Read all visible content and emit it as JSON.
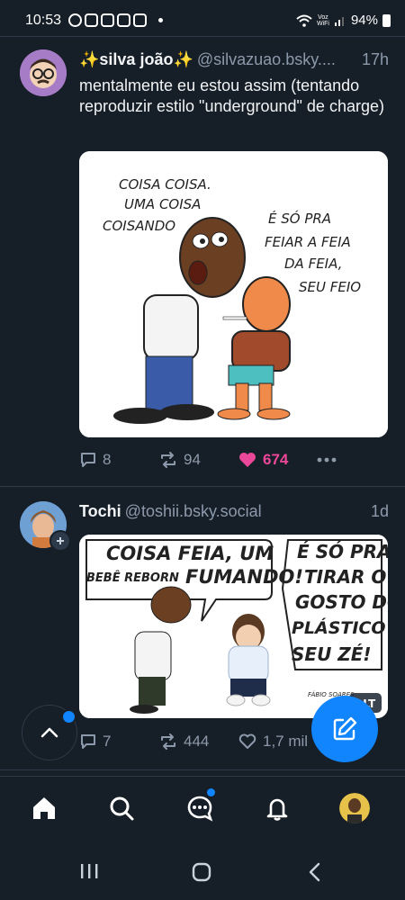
{
  "status_bar": {
    "time": "10:53",
    "voz_label": "Voz",
    "wifi_label": "WiFi",
    "battery": "94%"
  },
  "posts": [
    {
      "author": "✨silva joão✨",
      "handle": "@silvazuao.bsky....",
      "time": "17h",
      "text": "mentalmente eu estou assim (tentando reproduzir estilo \"underground\" de charge)",
      "comic_left_text": [
        "COISA COISA.",
        "UMA COISA",
        "COISANDO"
      ],
      "comic_right_text": [
        "É SÓ PRA",
        "FEIAR A FEIA",
        "DA FEIA,",
        "SEU FEIO"
      ],
      "replies": "8",
      "reposts": "94",
      "likes": "674"
    },
    {
      "author": "Tochi",
      "handle": "@toshii.bsky.social",
      "time": "1d",
      "comic_left_line1": "COISA FEIA, UM",
      "comic_left_small": "BEBÊ REBORN",
      "comic_left_line2": "FUMANDO!",
      "comic_right_text": [
        "É SÓ PRA",
        "TIRAR O",
        "GOSTO DO",
        "PLÁSTICO",
        "SEU ZÉ!"
      ],
      "comic_signature": "FÁBIO SOARES",
      "alt_badge": "ALT",
      "replies": "7",
      "reposts": "444",
      "likes": "1,7 mil"
    }
  ],
  "colors": {
    "background": "#161e27",
    "accent": "#1185fe",
    "like": "#ec4899",
    "muted": "#8d9aab"
  }
}
